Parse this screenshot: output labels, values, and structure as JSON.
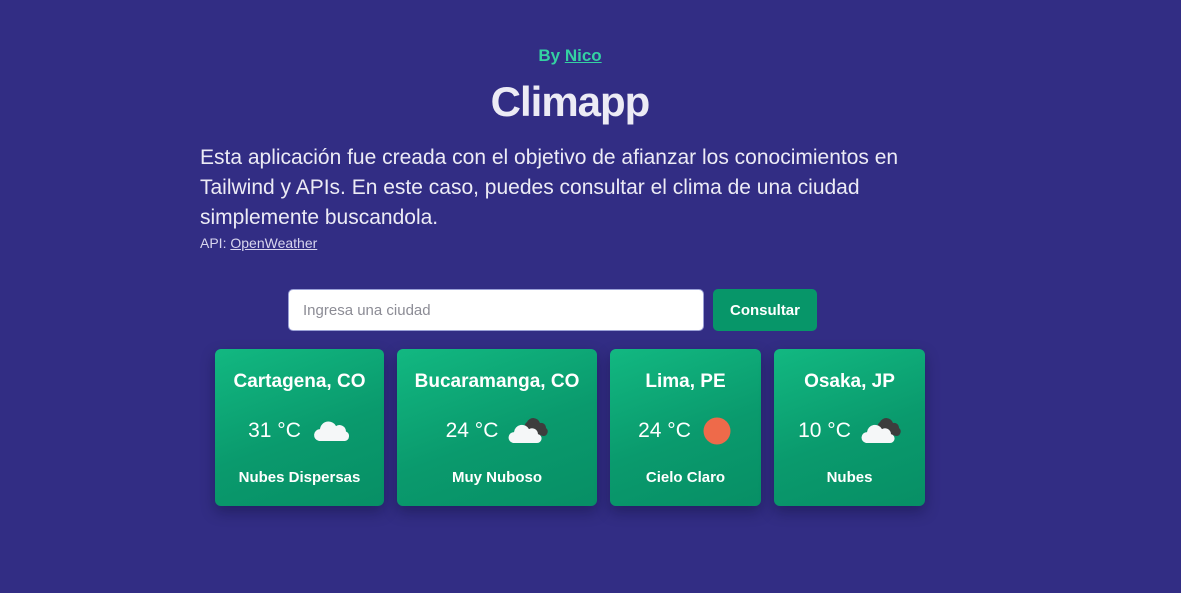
{
  "header": {
    "by_prefix": "By",
    "author": "Nico",
    "title": "Climapp",
    "description": "Esta aplicación fue creada con el objetivo de afianzar los conocimientos en Tailwind y APIs. En este caso, puedes consultar el clima de una ciudad simplemente buscandola.",
    "api_prefix": "API:",
    "api_link": "OpenWeather"
  },
  "search": {
    "placeholder": "Ingresa una ciudad",
    "value": "",
    "button_label": "Consultar"
  },
  "cards": [
    {
      "city": "Cartagena, CO",
      "temp": "31 °C",
      "icon": "cloud-icon",
      "condition": "Nubes Dispersas"
    },
    {
      "city": "Bucaramanga, CO",
      "temp": "24 °C",
      "icon": "broken-clouds-icon",
      "condition": "Muy Nuboso"
    },
    {
      "city": "Lima, PE",
      "temp": "24 °C",
      "icon": "sun-icon",
      "condition": "Cielo Claro"
    },
    {
      "city": "Osaka, JP",
      "temp": "10 °C",
      "icon": "broken-clouds-icon",
      "condition": "Nubes"
    }
  ],
  "colors": {
    "background": "#322d84",
    "accent": "#34d1a2",
    "card": "#0a9a6d",
    "button": "#079669",
    "sun": "#ee6a4a"
  }
}
